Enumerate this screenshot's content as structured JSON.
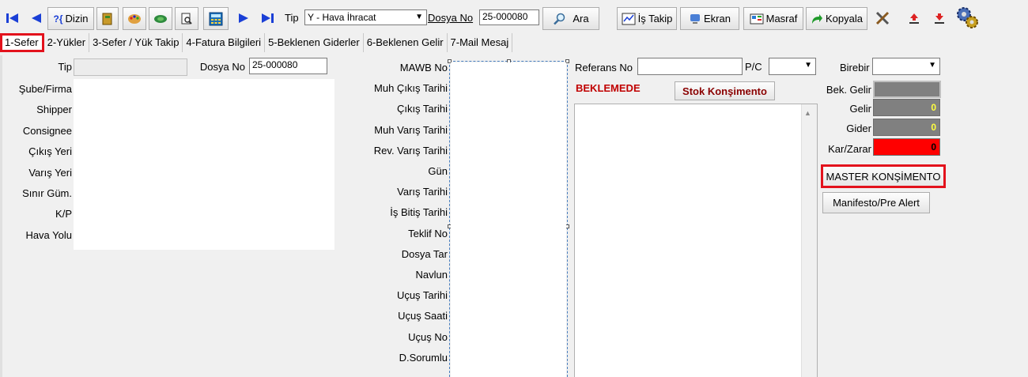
{
  "toolbar": {
    "dizin_label": "Dizin",
    "tip_label": "Tip",
    "tip_value": "Y - Hava İhracat",
    "dosya_no_label": "Dosya No",
    "dosya_no_value": "25-000080",
    "ara_label": "Ara",
    "is_takip_label": "İş Takip",
    "ekran_label": "Ekran",
    "masraf_label": "Masraf",
    "kopyala_label": "Kopyala"
  },
  "tabs": [
    {
      "label": "1-Sefer",
      "active": true
    },
    {
      "label": "2-Yükler"
    },
    {
      "label": "3-Sefer / Yük Takip"
    },
    {
      "label": "4-Fatura Bilgileri"
    },
    {
      "label": "5-Beklenen Giderler"
    },
    {
      "label": "6-Beklenen Gelir"
    },
    {
      "label": "7-Mail Mesaj"
    }
  ],
  "left": {
    "tip_label": "Tip",
    "dosya_no_label": "Dosya No",
    "dosya_no_value": "25-000080",
    "fields": [
      "Şube/Firma",
      "Shipper",
      "Consignee",
      "Çıkış Yeri",
      "Varış Yeri",
      "Sınır Güm.",
      "K/P",
      "Hava Yolu"
    ]
  },
  "middle": {
    "fields": [
      "MAWB No",
      "Muh Çıkış Tarihi",
      "Çıkış Tarihi",
      "Muh Varış Tarihi",
      "Rev. Varış Tarihi",
      "Gün",
      "Varış Tarihi",
      "İş Bitiş Tarihi",
      "Teklif No",
      "Dosya Tar",
      "Navlun",
      "Uçuş Tarihi",
      "Uçuş Saati",
      "Uçuş No",
      "D.Sorumlu"
    ]
  },
  "right": {
    "referans_no_label": "Referans No",
    "pc_label": "P/C",
    "status": "BEKLEMEDE",
    "stok_button": "Stok Konşimento"
  },
  "side": {
    "birebir_label": "Birebir",
    "bek_gelir_label": "Bek. Gelir",
    "gelir_label": "Gelir",
    "gelir_value": "0",
    "gider_label": "Gider",
    "gider_value": "0",
    "kar_zarar_label": "Kar/Zarar",
    "kar_zarar_value": "0",
    "master_button": "MASTER KONŞİMENTO",
    "manifesto_button": "Manifesto/Pre Alert"
  },
  "colors": {
    "highlight": "#e3121c",
    "status_text": "#c00000",
    "money_grey": "#808080",
    "money_yellow": "#ffff40",
    "kar_red": "#ff0000"
  }
}
